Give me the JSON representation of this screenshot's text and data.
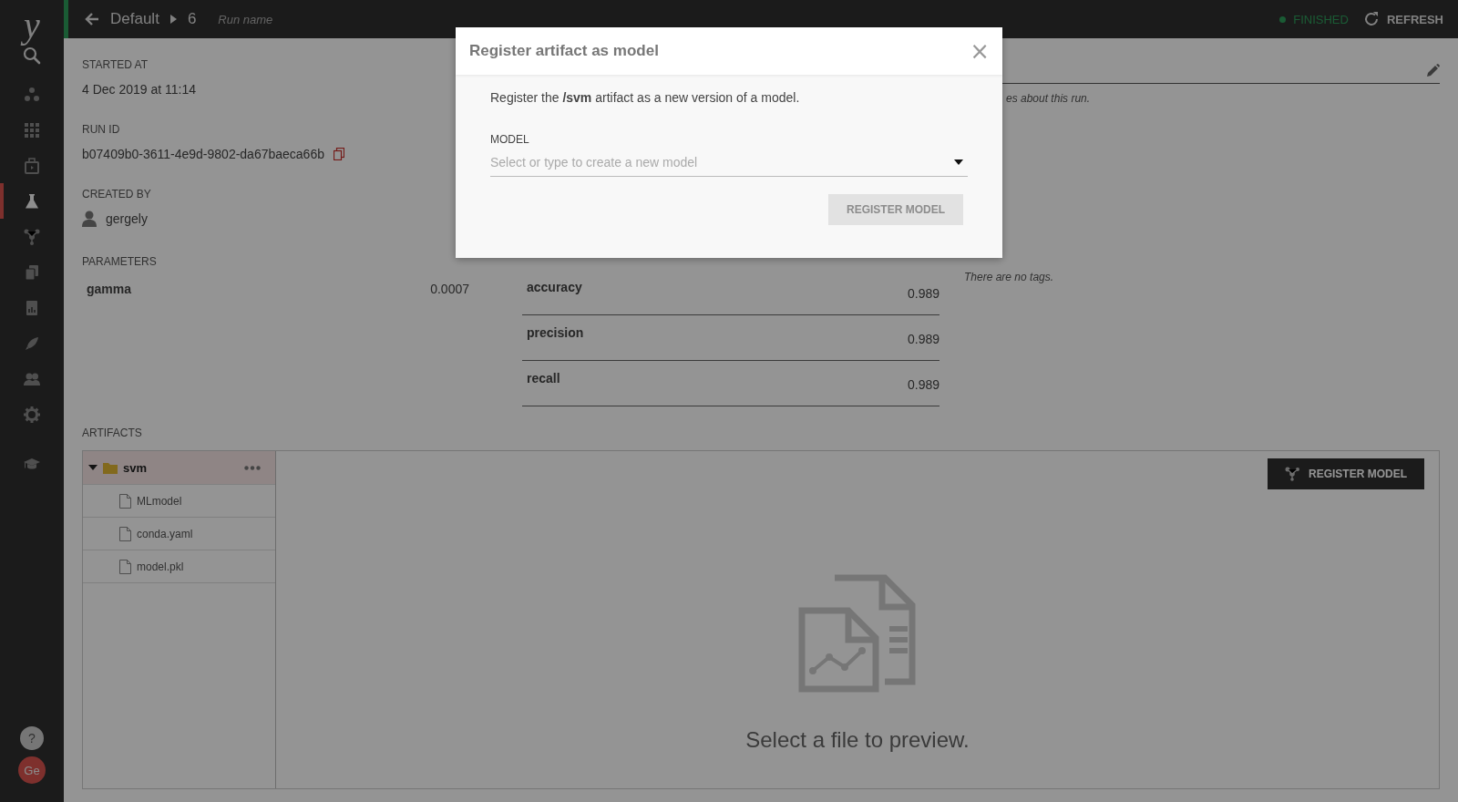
{
  "sidebar": {
    "logo": "y",
    "items": [
      {
        "kind": "search",
        "selected": false
      },
      {
        "kind": "dots",
        "selected": false
      },
      {
        "kind": "grid",
        "selected": false
      },
      {
        "kind": "box",
        "selected": false
      },
      {
        "kind": "flask",
        "selected": true
      },
      {
        "kind": "network",
        "selected": false
      },
      {
        "kind": "copies",
        "selected": false
      },
      {
        "kind": "report",
        "selected": false
      },
      {
        "kind": "rocket",
        "selected": false
      },
      {
        "kind": "users",
        "selected": false
      },
      {
        "kind": "gear",
        "selected": false
      },
      {
        "kind": "cap",
        "selected": false
      }
    ],
    "help": "?",
    "avatar": "Ge"
  },
  "header": {
    "breadcrumb": [
      "Default",
      "6"
    ],
    "run_name_placeholder": "Run name",
    "status": "FINISHED",
    "refresh": "REFRESH"
  },
  "run_fields": [
    {
      "kind": "text",
      "label": "STARTED AT",
      "value": "4 Dec 2019 at 11:14"
    },
    {
      "kind": "copy",
      "label": "RUN ID",
      "value": "b07409b0-3611-4e9d-9802-da67baeca66b"
    },
    {
      "kind": "user",
      "label": "CREATED BY",
      "value": "gergely"
    }
  ],
  "parameters": {
    "label": "PARAMETERS",
    "rows": [
      {
        "name": "gamma",
        "value": "0.0007"
      }
    ]
  },
  "metrics": {
    "rows": [
      {
        "name": "accuracy",
        "value": "0.989"
      },
      {
        "name": "precision",
        "value": "0.989"
      },
      {
        "name": "recall",
        "value": "0.989"
      }
    ]
  },
  "notes": {
    "hint": "es about this run."
  },
  "tags": {
    "empty": "There are no tags."
  },
  "artifacts": {
    "label": "ARTIFACTS",
    "tree": [
      {
        "kind": "folder",
        "name": "svm",
        "expanded": true,
        "selected": true,
        "children": [
          {
            "kind": "file",
            "name": "MLmodel",
            "selected": false
          },
          {
            "kind": "file",
            "name": "conda.yaml",
            "selected": false
          },
          {
            "kind": "file",
            "name": "model.pkl",
            "selected": false
          }
        ]
      }
    ],
    "register_button": "REGISTER MODEL",
    "preview_message": "Select a file to preview."
  },
  "modal": {
    "title": "Register artifact as model",
    "close": "×",
    "message": "Register the **/svm** artifact as a new version of a model.",
    "field_label": "MODEL",
    "placeholder": "Select or type to create a new model",
    "submit": "REGISTER MODEL",
    "submit_disabled": true
  }
}
